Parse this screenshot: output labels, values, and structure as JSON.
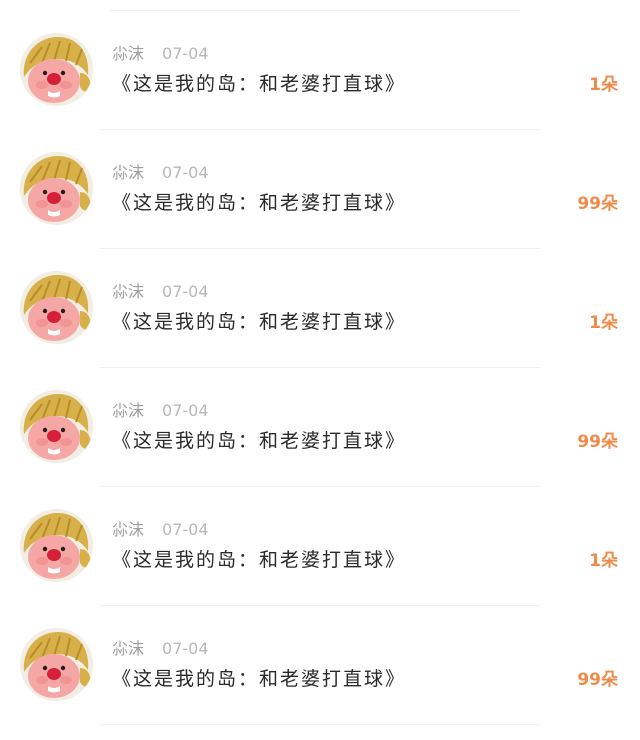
{
  "colors": {
    "accent": "#ef8b4a",
    "name": "#9e9e9e",
    "date": "#b8b8b8",
    "title": "#2a2a2a",
    "divider": "#efefef"
  },
  "list": {
    "items": [
      {
        "avatar_icon": "avatar-mascot-icon",
        "name": "尛沫",
        "date": "07-04",
        "title": "《这是我的岛：和老婆打直球》",
        "count": "1朵"
      },
      {
        "avatar_icon": "avatar-mascot-icon",
        "name": "尛沫",
        "date": "07-04",
        "title": "《这是我的岛：和老婆打直球》",
        "count": "99朵"
      },
      {
        "avatar_icon": "avatar-mascot-icon",
        "name": "尛沫",
        "date": "07-04",
        "title": "《这是我的岛：和老婆打直球》",
        "count": "1朵"
      },
      {
        "avatar_icon": "avatar-mascot-icon",
        "name": "尛沫",
        "date": "07-04",
        "title": "《这是我的岛：和老婆打直球》",
        "count": "99朵"
      },
      {
        "avatar_icon": "avatar-mascot-icon",
        "name": "尛沫",
        "date": "07-04",
        "title": "《这是我的岛：和老婆打直球》",
        "count": "1朵"
      },
      {
        "avatar_icon": "avatar-mascot-icon",
        "name": "尛沫",
        "date": "07-04",
        "title": "《这是我的岛：和老婆打直球》",
        "count": "99朵"
      }
    ]
  }
}
